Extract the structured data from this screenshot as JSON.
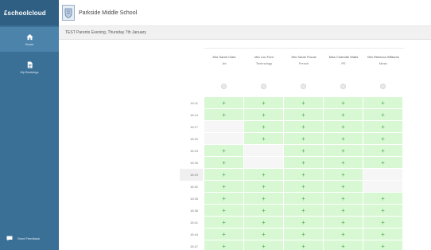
{
  "app": {
    "logo_bold": "schoolcloud",
    "logo_light": "",
    "logo_full": "£schoolcloud"
  },
  "sidebar": {
    "items": [
      {
        "label": "Home",
        "icon": "home-icon"
      },
      {
        "label": "My Bookings",
        "icon": "document-icon"
      }
    ],
    "feedback_label": "Send Feedback",
    "colors": {
      "background": "#3a6f96",
      "active": "#4c83ab",
      "logo_bar": "#2f5f83"
    }
  },
  "header": {
    "school_name": "Parkside Middle School",
    "event_title": "TEST Parents Evening, Thursday 7th January"
  },
  "teachers": [
    {
      "name": "Mrs Sarah Clark",
      "subject": "Art"
    },
    {
      "name": "Mrs Lou Ford",
      "subject": "Technology"
    },
    {
      "name": "Mrs Sarah Proust",
      "subject": "French"
    },
    {
      "name": "Miss Charlotte Watts",
      "subject": "PE"
    },
    {
      "name": "Mrs Rebecca Williams",
      "subject": "Music"
    }
  ],
  "slots": [
    {
      "time": "15:11",
      "cells": [
        "+",
        "+",
        "+",
        "+",
        "+"
      ]
    },
    {
      "time": "15:14",
      "cells": [
        "+",
        "+",
        "+",
        "+",
        "+"
      ]
    },
    {
      "time": "15:17",
      "cells": [
        "",
        "+",
        "+",
        "+",
        "+"
      ]
    },
    {
      "time": "15:20",
      "cells": [
        "",
        "+",
        "+",
        "+",
        "+"
      ]
    },
    {
      "time": "15:23",
      "cells": [
        "+",
        "",
        "+",
        "+",
        "+"
      ]
    },
    {
      "time": "15:26",
      "cells": [
        "+",
        "",
        "+",
        "+",
        "+"
      ]
    },
    {
      "time": "15:29",
      "cells": [
        "+",
        "+",
        "+",
        "+",
        ""
      ]
    },
    {
      "time": "15:32",
      "cells": [
        "+",
        "+",
        "+",
        "+",
        ""
      ]
    },
    {
      "time": "15:35",
      "cells": [
        "+",
        "+",
        "+",
        "+",
        "+"
      ]
    },
    {
      "time": "15:38",
      "cells": [
        "+",
        "+",
        "+",
        "+",
        "+"
      ]
    },
    {
      "time": "15:41",
      "cells": [
        "+",
        "+",
        "+",
        "+",
        "+"
      ]
    },
    {
      "time": "15:44",
      "cells": [
        "+",
        "+",
        "+",
        "+",
        "+"
      ]
    },
    {
      "time": "15:47",
      "cells": [
        "+",
        "+",
        "+",
        "+",
        "+"
      ]
    }
  ],
  "highlight_time": "15:29",
  "colors": {
    "available": "#d8f8d3",
    "plus": "#4caf50",
    "unavailable": "#f6f6f6"
  }
}
